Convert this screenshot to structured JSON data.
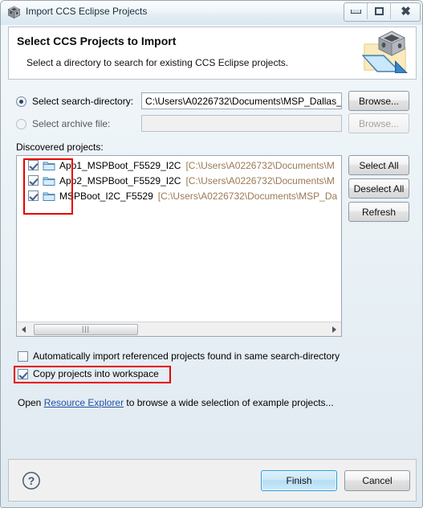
{
  "window": {
    "title": "Import CCS Eclipse Projects",
    "icon": "ccs-cube-icon",
    "controls": {
      "minimize": "minimize-icon",
      "maximize": "maximize-icon",
      "close": "close-icon"
    }
  },
  "header": {
    "title": "Select CCS Projects to Import",
    "subtitle": "Select a directory to search for existing CCS Eclipse projects.",
    "icon": "import-folder-icon"
  },
  "source": {
    "search_directory": {
      "radio_label": "Select search-directory:",
      "selected": true,
      "value": "C:\\Users\\A0226732\\Documents\\MSP_Dallas_",
      "browse_label": "Browse..."
    },
    "archive_file": {
      "radio_label": "Select archive file:",
      "selected": false,
      "value": "",
      "browse_label": "Browse...",
      "disabled": true
    }
  },
  "projects": {
    "section_label": "Discovered projects:",
    "items": [
      {
        "checked": true,
        "name": "App1_MSPBoot_F5529_I2C",
        "path": "[C:\\Users\\A0226732\\Documents\\M",
        "icon": "folder-icon"
      },
      {
        "checked": true,
        "name": "App2_MSPBoot_F5529_I2C",
        "path": "[C:\\Users\\A0226732\\Documents\\M",
        "icon": "folder-icon"
      },
      {
        "checked": true,
        "name": "MSPBoot_I2C_F5529",
        "path": "[C:\\Users\\A0226732\\Documents\\MSP_Da",
        "icon": "folder-icon"
      }
    ],
    "buttons": {
      "select_all": "Select All",
      "deselect_all": "Deselect All",
      "refresh": "Refresh"
    },
    "scrollbar": {
      "left_arrow": "scroll-left-icon",
      "right_arrow": "scroll-right-icon",
      "grip": "|||"
    }
  },
  "options": {
    "auto_import": {
      "label": "Automatically import referenced projects found in same search-directory",
      "checked": false
    },
    "copy_projects": {
      "label": "Copy projects into workspace",
      "checked": true
    }
  },
  "hint": {
    "prefix": "Open ",
    "link": "Resource Explorer",
    "suffix": " to browse a wide selection of example projects..."
  },
  "footer": {
    "help": "help-icon",
    "finish": "Finish",
    "cancel": "Cancel"
  },
  "annotations": {
    "accent_color": "#e60000",
    "boxes": [
      "project-checkboxes",
      "copy-projects-into-workspace"
    ]
  }
}
